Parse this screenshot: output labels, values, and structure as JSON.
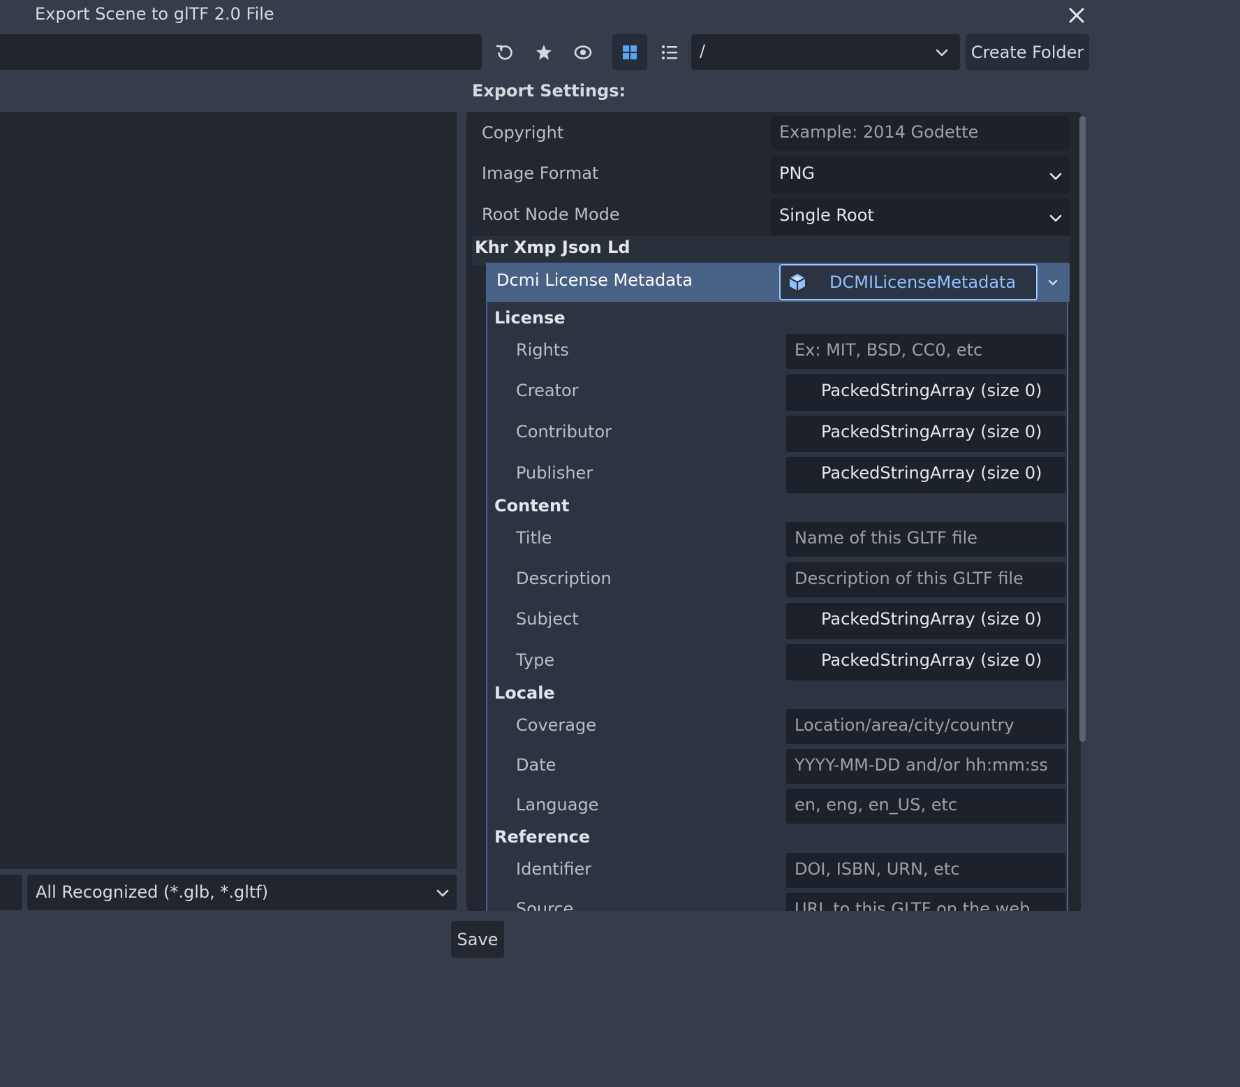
{
  "window": {
    "title": "Export Scene to glTF 2.0 File"
  },
  "toolbar": {
    "path_value": "/",
    "create_folder": "Create Folder"
  },
  "filter": {
    "selected": "All Recognized (*.glb, *.gltf)"
  },
  "settings": {
    "label": "Export Settings:",
    "copyright_label": "Copyright",
    "copyright_placeholder": "Example: 2014 Godette",
    "image_format_label": "Image Format",
    "image_format_value": "PNG",
    "root_node_mode_label": "Root Node Mode",
    "root_node_mode_value": "Single Root",
    "khr_section": "Khr Xmp Json Ld",
    "dcmi_label": "Dcmi License Metadata",
    "dcmi_value": "DCMILicenseMetadata",
    "license_section": "License",
    "rights_label": "Rights",
    "rights_placeholder": "Ex: MIT, BSD, CC0, etc",
    "creator_label": "Creator",
    "creator_value": "PackedStringArray (size 0)",
    "contributor_label": "Contributor",
    "contributor_value": "PackedStringArray (size 0)",
    "publisher_label": "Publisher",
    "publisher_value": "PackedStringArray (size 0)",
    "content_section": "Content",
    "title_label": "Title",
    "title_placeholder": "Name of this GLTF file",
    "description_label": "Description",
    "description_placeholder": "Description of this GLTF file",
    "subject_label": "Subject",
    "subject_value": "PackedStringArray (size 0)",
    "type_label": "Type",
    "type_value": "PackedStringArray (size 0)",
    "locale_section": "Locale",
    "coverage_label": "Coverage",
    "coverage_placeholder": "Location/area/city/country",
    "date_label": "Date",
    "date_placeholder": "YYYY-MM-DD and/or hh:mm:ss",
    "language_label": "Language",
    "language_placeholder": "en, eng, en_US, etc",
    "reference_section": "Reference",
    "identifier_label": "Identifier",
    "identifier_placeholder": "DOI, ISBN, URN, etc",
    "source_label": "Source",
    "source_placeholder": "URL to this GLTF on the web"
  },
  "footer": {
    "save": "Save"
  },
  "icons": {
    "refresh": "refresh-icon",
    "favorite": "star-icon",
    "hidden": "eye-icon",
    "grid": "grid-view-icon",
    "list": "list-view-icon",
    "close": "close-icon",
    "resource": "cube-resource-icon"
  },
  "colors": {
    "accent": "#5aa4f5",
    "selected_row": "#476286",
    "link_text": "#8fc0ff"
  }
}
